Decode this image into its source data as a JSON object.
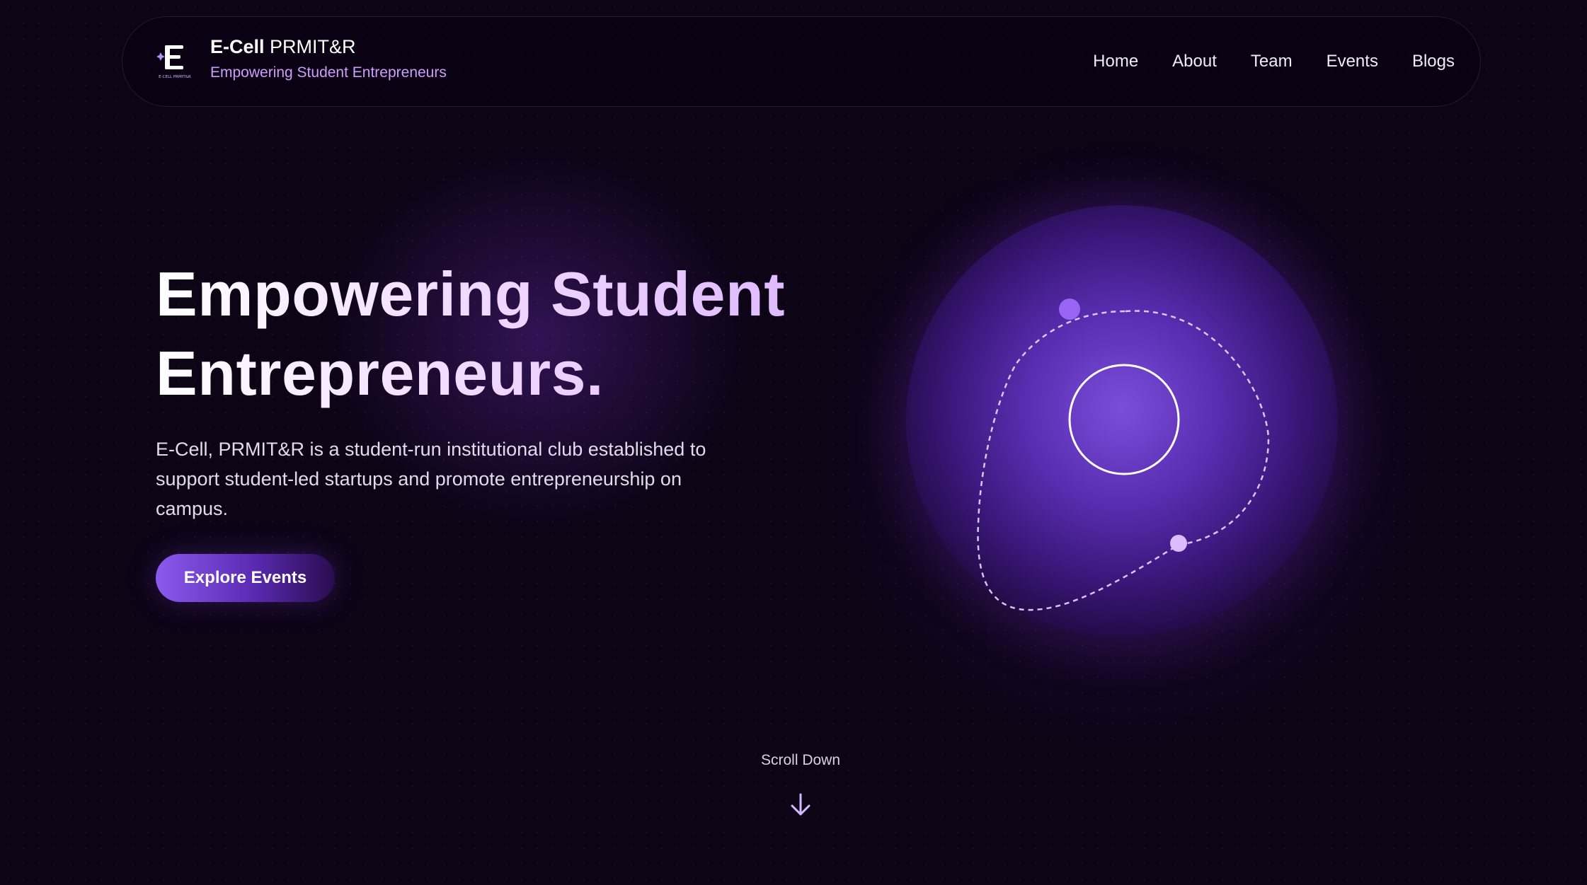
{
  "nav": {
    "brand_bold": "E-Cell",
    "brand_rest": " PRMIT&R",
    "brand_tagline": "Empowering Student Entrepreneurs",
    "logo_text": "E-CELL PRMIT&R",
    "links": [
      "Home",
      "About",
      "Team",
      "Events",
      "Blogs"
    ]
  },
  "hero": {
    "title_line1": "Empowering Student",
    "title_line2": "Entrepreneurs.",
    "description": "E-Cell, PRMIT&R is a student-run institutional club established to support student-led startups and promote entrepreneurship on campus.",
    "cta_label": "Explore Events"
  },
  "scroll": {
    "label": "Scroll Down",
    "icon": "arrow-down-icon"
  },
  "colors": {
    "background": "#0d0416",
    "accent": "#8c5aee",
    "tagline": "#cf9dff",
    "orb_core": "#7a4ed8"
  }
}
